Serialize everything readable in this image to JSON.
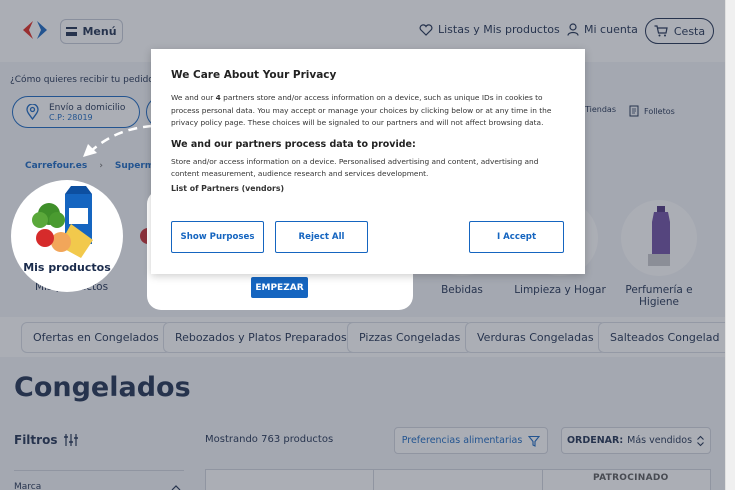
{
  "header": {
    "menu_label": "Menú",
    "lists_label": "Listas y Mis productos",
    "account_label": "Mi cuenta",
    "cart_label": "Cesta"
  },
  "delivery": {
    "question": "¿Cómo quieres recibir tu pedido",
    "home_label": "Envío a domicilio",
    "postal_code": "C.P: 28019",
    "stores_label": "Tiendas",
    "leaflets_label": "Folletos"
  },
  "breadcrumb": [
    "Carrefour.es",
    "Supermer"
  ],
  "categories": {
    "mis_productos": "Mis productos",
    "mis_productos_sub": "Mis productos",
    "items": [
      "Bebidas",
      "Limpieza y Hogar",
      "Perfumería e Higiene"
    ]
  },
  "tour": {
    "start_label": "EMPEZAR"
  },
  "chips": [
    "Ofertas en Congelados",
    "Rebozados y Platos Preparados",
    "Pizzas Congeladas",
    "Verduras Congeladas",
    "Salteados Congelad"
  ],
  "page_title": "Congelados",
  "filters_label": "Filtros",
  "showing_text": "Mostrando 763 productos",
  "preferences_label": "Preferencias alimentarias",
  "order": {
    "label": "ORDENAR:",
    "value": "Más vendidos"
  },
  "brand_label": "Marca",
  "sponsored_label": "PATROCINADO",
  "privacy": {
    "title": "We Care About Your Privacy",
    "body_1": "We and our ",
    "partners_count": "4",
    "body_2": " partners store and/or access information on a device, such as unique IDs in cookies to process personal data. You may accept or manage your choices by clicking below or at any time in the privacy policy page. These choices will be signaled to our partners and will not affect browsing data.",
    "subtitle": "We and our partners process data to provide:",
    "purposes": "Store and/or access information on a device. Personalised advertising and content, advertising and content measurement, audience research and services development.",
    "list_partners": "List of Partners (vendors)",
    "show_purposes": "Show Purposes",
    "reject_all": "Reject All",
    "accept": "I Accept"
  },
  "colors": {
    "brand_blue": "#1565c0",
    "brand_red": "#e1251b",
    "text_navy": "#1a2b4c"
  }
}
